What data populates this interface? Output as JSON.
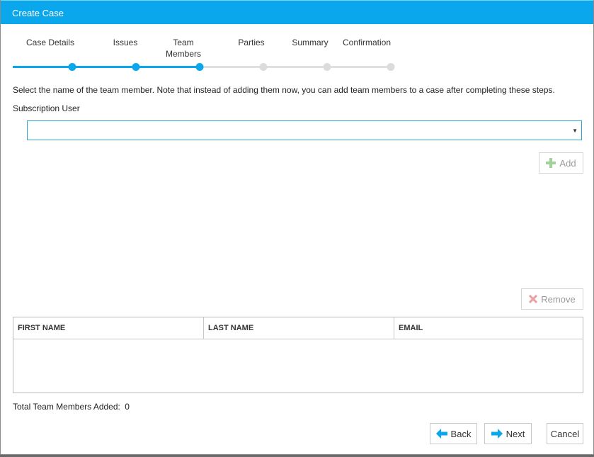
{
  "window": {
    "title": "Create Case"
  },
  "stepper": {
    "steps": [
      {
        "label": "Case Details",
        "state": "done"
      },
      {
        "label": "Issues",
        "state": "done"
      },
      {
        "label": "Team\nMembers",
        "state": "current"
      },
      {
        "label": "Parties",
        "state": "todo"
      },
      {
        "label": "Summary",
        "state": "todo"
      },
      {
        "label": "Confirmation",
        "state": "todo"
      }
    ],
    "colors": {
      "done": "#0aa7ec",
      "todo": "#dcdcdc"
    }
  },
  "form": {
    "instruction": "Select the name of the team member. Note that instead of adding them now, you can add team members to a case after completing these steps.",
    "subscription_user_label": "Subscription User",
    "subscription_user_value": "",
    "add_label": "Add",
    "remove_label": "Remove"
  },
  "table": {
    "columns": [
      "FIRST NAME",
      "LAST NAME",
      "EMAIL"
    ],
    "rows": []
  },
  "footer": {
    "total_label": "Total Team Members Added:",
    "total_count": "0",
    "back_label": "Back",
    "next_label": "Next",
    "cancel_label": "Cancel"
  }
}
